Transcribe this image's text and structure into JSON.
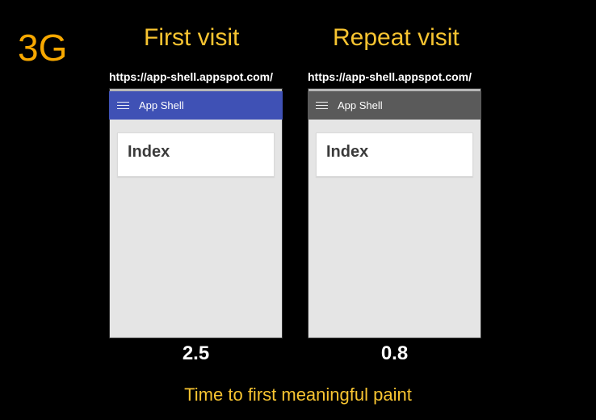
{
  "network": "3G",
  "caption": "Time to first meaningful paint",
  "columns": {
    "first": {
      "heading": "First visit",
      "url": "https://app-shell.appspot.com/",
      "toolbar_title": "App Shell",
      "card_title": "Index",
      "toolbar_variant": "blue",
      "timing_seconds": "2.5"
    },
    "repeat": {
      "heading": "Repeat visit",
      "url": "https://app-shell.appspot.com/",
      "toolbar_title": "App Shell",
      "card_title": "Index",
      "toolbar_variant": "grey",
      "timing_seconds": "0.8"
    }
  }
}
